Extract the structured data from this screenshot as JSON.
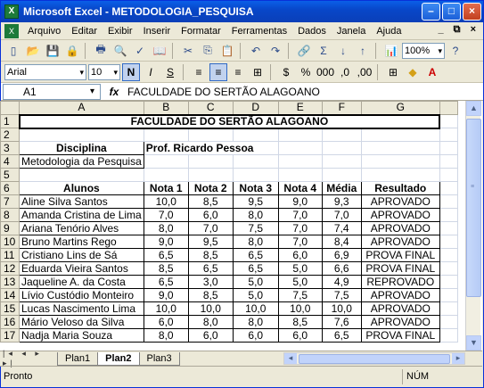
{
  "window": {
    "title": "Microsoft Excel - METODOLOGIA_PESQUISA",
    "app_icon": "X"
  },
  "menu": {
    "items": [
      {
        "label": "Arquivo"
      },
      {
        "label": "Editar"
      },
      {
        "label": "Exibir"
      },
      {
        "label": "Inserir"
      },
      {
        "label": "Formatar"
      },
      {
        "label": "Ferramentas"
      },
      {
        "label": "Dados"
      },
      {
        "label": "Janela"
      },
      {
        "label": "Ajuda"
      }
    ],
    "window_controls": "_ ⧉ ×"
  },
  "toolbar": {
    "zoom": "100%"
  },
  "format_bar": {
    "font": "Arial",
    "size": "10",
    "bold": "N",
    "italic": "I",
    "underline": "S"
  },
  "formula_bar": {
    "name_box": "A1",
    "fx": "fx",
    "content": "FACULDADE DO SERTÃO ALAGOANO"
  },
  "columns": [
    "A",
    "B",
    "C",
    "D",
    "E",
    "F",
    "G"
  ],
  "sheet": {
    "title": "FACULDADE DO SERTÃO ALAGOANO",
    "disciplina_label": "Disciplina",
    "professor": "Prof. Ricardo Pessoa",
    "disciplina": "Metodologia da Pesquisa",
    "headers": [
      "Alunos",
      "Nota 1",
      "Nota 2",
      "Nota 3",
      "Nota 4",
      "Média",
      "Resultado"
    ],
    "rows": [
      [
        "Aline Silva Santos",
        "10,0",
        "8,5",
        "9,5",
        "9,0",
        "9,3",
        "APROVADO"
      ],
      [
        "Amanda Cristina de Lima",
        "7,0",
        "6,0",
        "8,0",
        "7,0",
        "7,0",
        "APROVADO"
      ],
      [
        "Ariana Tenório Alves",
        "8,0",
        "7,0",
        "7,5",
        "7,0",
        "7,4",
        "APROVADO"
      ],
      [
        "Bruno Martins Rego",
        "9,0",
        "9,5",
        "8,0",
        "7,0",
        "8,4",
        "APROVADO"
      ],
      [
        "Cristiano Lins de Sá",
        "6,5",
        "8,5",
        "6,5",
        "6,0",
        "6,9",
        "PROVA FINAL"
      ],
      [
        "Eduarda Vieira Santos",
        "8,5",
        "6,5",
        "6,5",
        "5,0",
        "6,6",
        "PROVA FINAL"
      ],
      [
        "Jaqueline A. da Costa",
        "6,5",
        "3,0",
        "5,0",
        "5,0",
        "4,9",
        "REPROVADO"
      ],
      [
        "Lívio Custódio Monteiro",
        "9,0",
        "8,5",
        "5,0",
        "7,5",
        "7,5",
        "APROVADO"
      ],
      [
        "Lucas Nascimento Lima",
        "10,0",
        "10,0",
        "10,0",
        "10,0",
        "10,0",
        "APROVADO"
      ],
      [
        "Mário Veloso da Silva",
        "6,0",
        "8,0",
        "8,0",
        "8,5",
        "7,6",
        "APROVADO"
      ],
      [
        "Nadja Maria Souza",
        "8,0",
        "6,0",
        "6,0",
        "6,0",
        "6,5",
        "PROVA FINAL"
      ]
    ]
  },
  "tabs": [
    {
      "label": "Plan1",
      "active": false
    },
    {
      "label": "Plan2",
      "active": true
    },
    {
      "label": "Plan3",
      "active": false
    }
  ],
  "status": {
    "ready": "Pronto",
    "num": "NÚM"
  }
}
